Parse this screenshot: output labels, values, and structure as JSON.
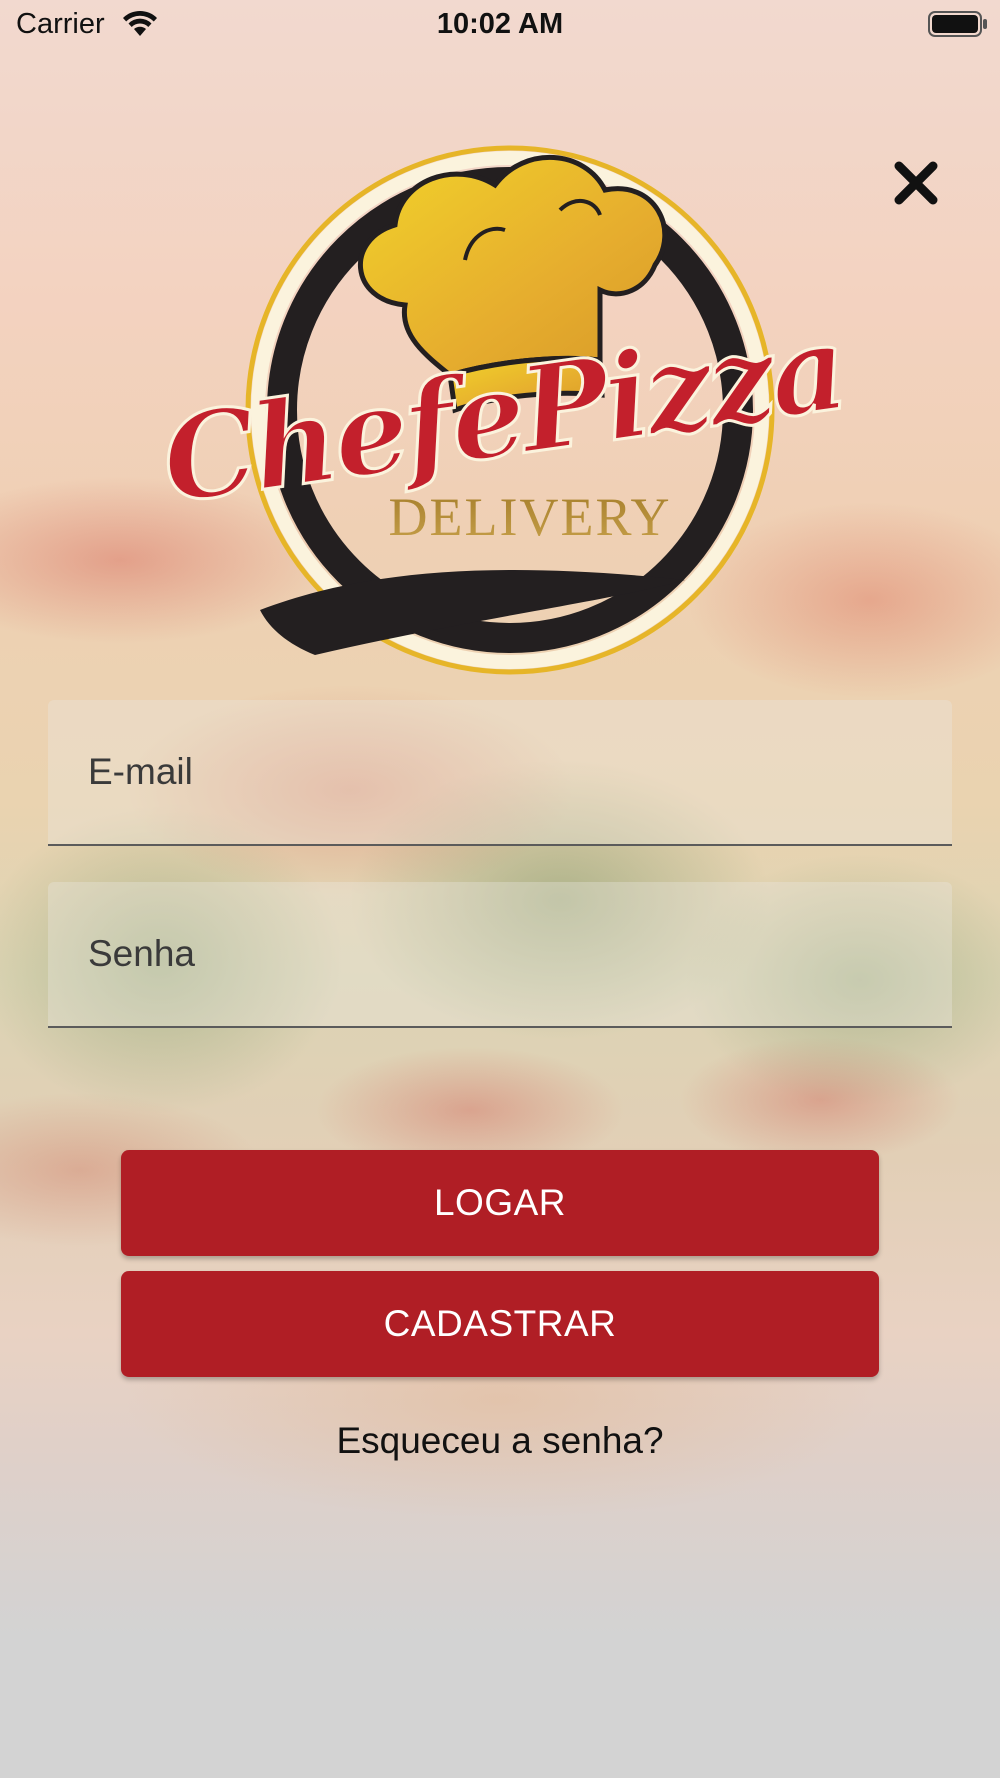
{
  "status_bar": {
    "carrier": "Carrier",
    "time": "10:02 AM",
    "icons": [
      "wifi-icon",
      "battery-icon"
    ]
  },
  "close_icon": "close-icon",
  "logo": {
    "name": "Chefe Pizza Delivery logo",
    "colors": {
      "ring": "#231f20",
      "script_red": "#c3202c",
      "gold": "#e2b33a",
      "delivery": "#a8822a"
    }
  },
  "form": {
    "email_placeholder": "E-mail",
    "email_value": "",
    "password_placeholder": "Senha",
    "password_value": ""
  },
  "buttons": {
    "login_label": "LOGAR",
    "register_label": "CADASTRAR"
  },
  "forgot_password_label": "Esqueceu a senha?",
  "colors": {
    "primary": "#b01e25",
    "button_text": "#ffffff",
    "text": "#111111"
  }
}
